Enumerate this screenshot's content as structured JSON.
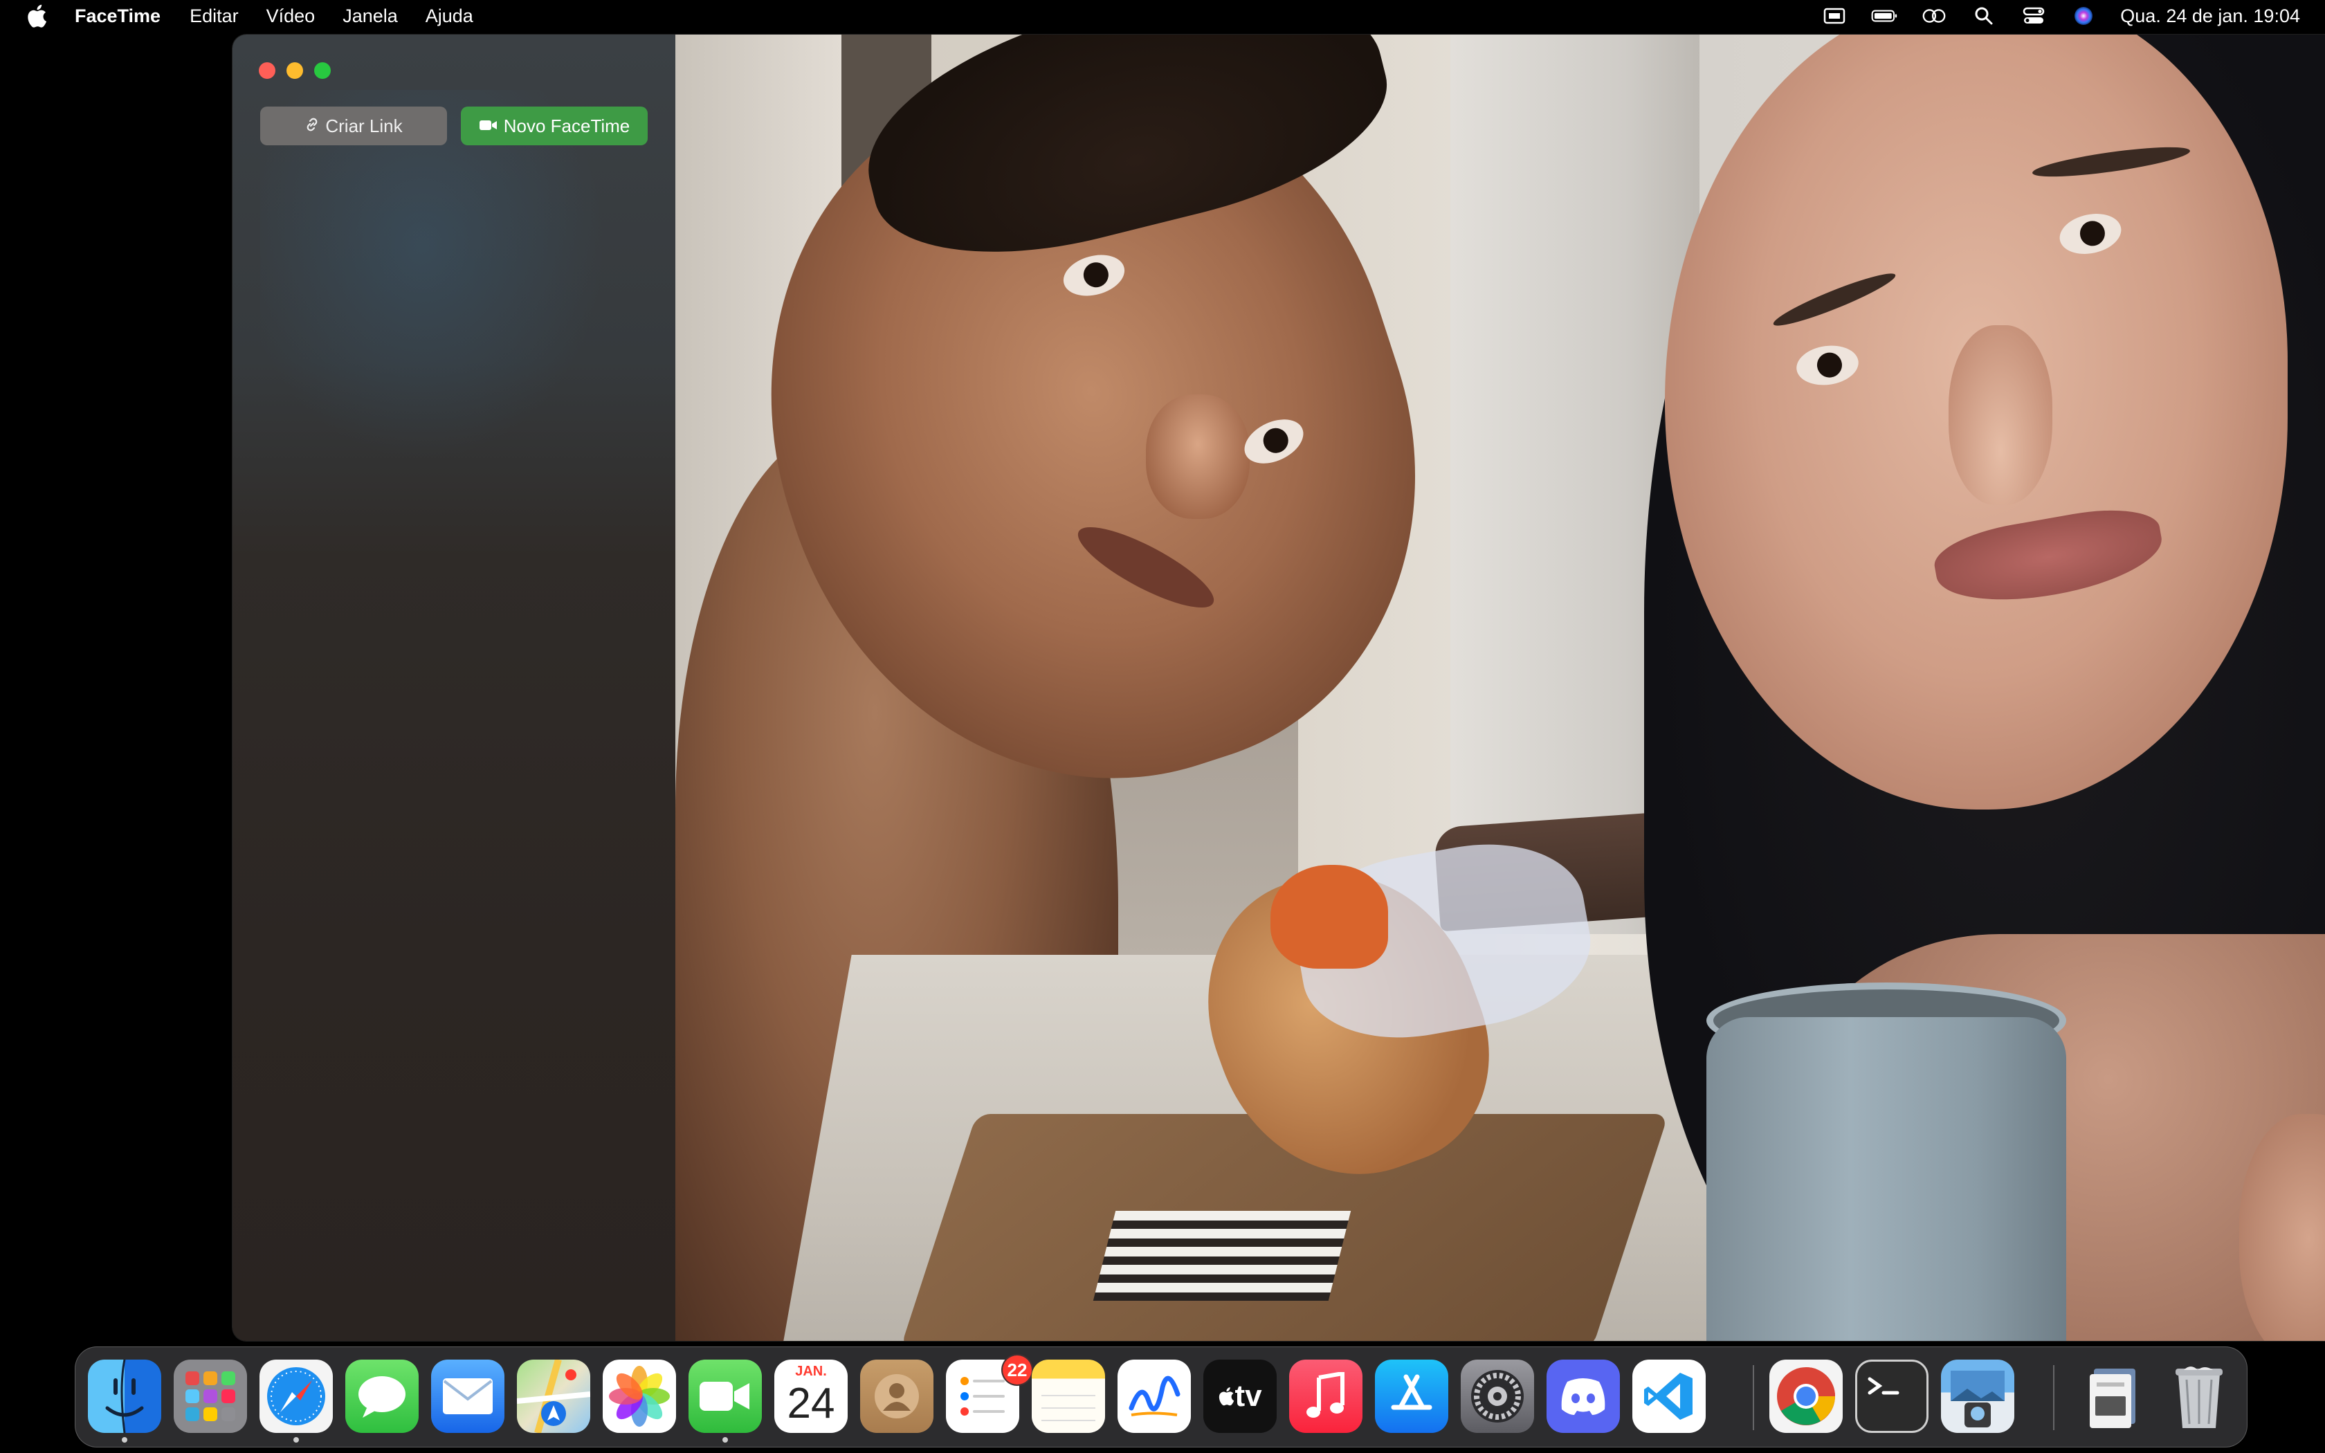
{
  "menubar": {
    "app_name": "FaceTime",
    "menus": [
      "Editar",
      "Vídeo",
      "Janela",
      "Ajuda"
    ],
    "clock": "Qua. 24 de jan.  19:04",
    "status_icons": [
      "screen-icon",
      "battery-icon",
      "screen-mirroring-icon",
      "spotlight-icon",
      "control-center-icon",
      "siri-icon"
    ]
  },
  "window": {
    "sidebar": {
      "create_link_label": "Criar Link",
      "new_facetime_label": "Novo FaceTime"
    },
    "colors": {
      "close": "#fe5f57",
      "minimize": "#febc2e",
      "maximize": "#28c840",
      "new_facetime_button": "#3e9b45",
      "create_link_button": "#6f6d6c"
    }
  },
  "dock": {
    "apps": [
      {
        "name": "Finder",
        "icon": "finder-icon",
        "running": true
      },
      {
        "name": "Launchpad",
        "icon": "launchpad-icon",
        "running": false
      },
      {
        "name": "Safari",
        "icon": "safari-icon",
        "running": true
      },
      {
        "name": "Mensagens",
        "icon": "messages-icon",
        "running": false
      },
      {
        "name": "Mail",
        "icon": "mail-icon",
        "running": false
      },
      {
        "name": "Mapas",
        "icon": "maps-icon",
        "running": false
      },
      {
        "name": "Fotos",
        "icon": "photos-icon",
        "running": false
      },
      {
        "name": "FaceTime",
        "icon": "facetime-icon",
        "running": true
      },
      {
        "name": "Calendário",
        "icon": "calendar-icon",
        "running": false
      },
      {
        "name": "Contatos",
        "icon": "contacts-icon",
        "running": false
      },
      {
        "name": "Lembretes",
        "icon": "reminders-icon",
        "running": false
      },
      {
        "name": "Notas",
        "icon": "notes-icon",
        "running": false
      },
      {
        "name": "Freeform",
        "icon": "freeform-icon",
        "running": false
      },
      {
        "name": "TV",
        "icon": "appletv-icon",
        "running": false
      },
      {
        "name": "Música",
        "icon": "music-icon",
        "running": false
      },
      {
        "name": "App Store",
        "icon": "appstore-icon",
        "running": false
      },
      {
        "name": "Ajustes do Sistema",
        "icon": "settings-icon",
        "running": false
      },
      {
        "name": "Discord",
        "icon": "discord-icon",
        "running": false
      },
      {
        "name": "Visual Studio Code",
        "icon": "vscode-icon",
        "running": false
      },
      {
        "name": "Google Chrome",
        "icon": "chrome-icon",
        "running": false
      },
      {
        "name": "Terminal",
        "icon": "terminal-icon",
        "running": false
      },
      {
        "name": "Pré-Visualização",
        "icon": "preview-icon",
        "running": false
      },
      {
        "name": "Downloads",
        "icon": "downloads-stack-icon",
        "running": false
      },
      {
        "name": "Lixo",
        "icon": "trash-icon",
        "running": false
      }
    ],
    "calendar": {
      "month": "JAN.",
      "day": "24"
    },
    "reminders_badge": "22",
    "tv_label": "tv"
  }
}
